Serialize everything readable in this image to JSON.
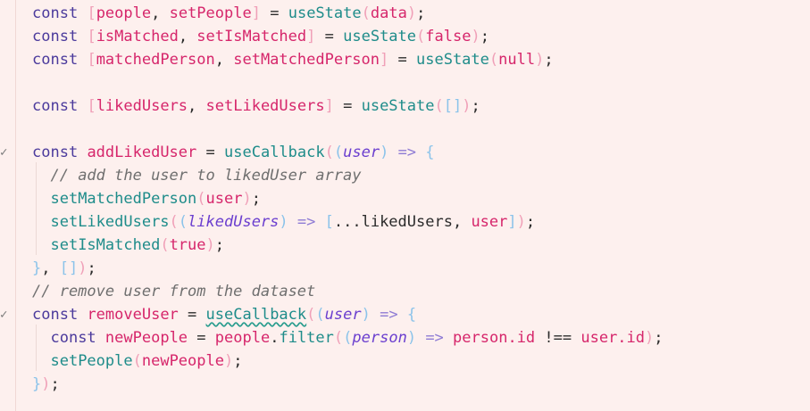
{
  "editor": {
    "fold_markers": [
      "✓",
      "✓"
    ],
    "lines": [
      "const [people, setPeople] = useState(data);",
      "const [isMatched, setIsMatched] = useState(false);",
      "const [matchedPerson, setMatchedPerson] = useState(null);",
      "",
      "const [likedUsers, setLikedUsers] = useState([]);",
      "",
      "const addLikedUser = useCallback((user) => {",
      "  // add the user to likedUser array",
      "  setMatchedPerson(user);",
      "  setLikedUsers((likedUsers) => [...likedUsers, user]);",
      "  setIsMatched(true);",
      "}, []);",
      "// remove user from the dataset",
      "const removeUser = useCallback((user) => {",
      "  const newPeople = people.filter((person) => person.id !== user.id);",
      "  setPeople(newPeople);",
      "});"
    ],
    "tokens": {
      "const": "const",
      "people": "people",
      "setPeople": "setPeople",
      "useState": "useState",
      "data": "data",
      "isMatched": "isMatched",
      "setIsMatched": "setIsMatched",
      "false": "false",
      "matchedPerson": "matchedPerson",
      "setMatchedPerson": "setMatchedPerson",
      "null": "null",
      "likedUsers": "likedUsers",
      "setLikedUsers": "setLikedUsers",
      "addLikedUser": "addLikedUser",
      "useCallback": "useCallback",
      "user": "user",
      "comment1": "// add the user to likedUser array",
      "spread": "...likedUsers",
      "true": "true",
      "comment2": "// remove user from the dataset",
      "removeUser": "removeUser",
      "newPeople": "newPeople",
      "filter": "filter",
      "person": "person",
      "person_id": "person.id",
      "user_id": "user.id"
    }
  }
}
